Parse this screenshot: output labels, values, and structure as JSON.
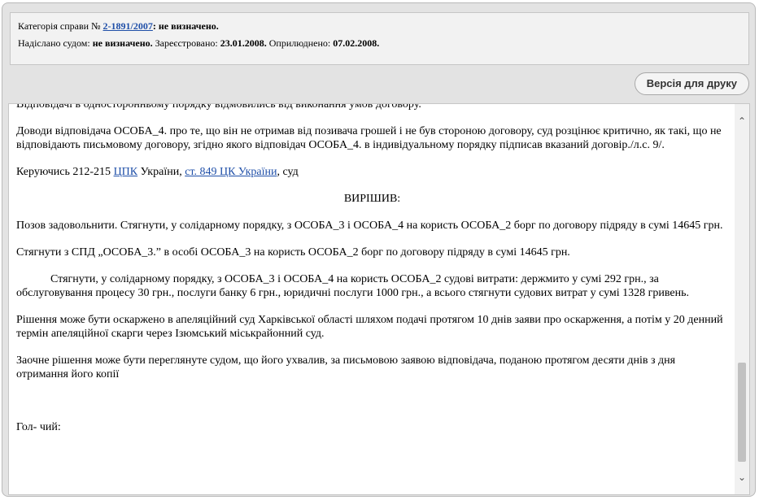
{
  "header": {
    "category_prefix": "Категорія справи №",
    "case_number": "2-1891/2007",
    "category_value": ": не визначено.",
    "sent_label": "Надіслано судом:",
    "sent_value": "не визначено.",
    "registered_label": "Зареєстровано:",
    "registered_value": "23.01.2008.",
    "published_label": "Оприлюднено:",
    "published_value": "07.02.2008."
  },
  "toolbar": {
    "print_label": "Версія для друку"
  },
  "document": {
    "p0": "Відповідачі в односторонньому порядку відмовились від виконання умов договору.",
    "p1": "Доводи відповідача ОСОБА_4. про те, що він не отримав від позивача грошей і не був стороною договору, суд розцінює критично, як такі, що не відповідають письмовому договору, згідно якого відповідач ОСОБА_4. в індивідуальному порядку підписав вказаний договір./л.с. 9/.",
    "p2_start": "Керуючись 212-215 ",
    "p2_link1": "ЦПК",
    "p2_mid": " України, ",
    "p2_link2": "ст. 849 ЦК України",
    "p2_end": ", суд",
    "decided": "ВИРІШИВ:",
    "p3": "Позов задовольнити. Стягнути, у солідарному порядку, з ОСОБА_3 і ОСОБА_4 на користь ОСОБА_2 борг по договору підряду в сумі 14645 грн.",
    "p4": "Стягнути з СПД „ОСОБА_3.” в особі ОСОБА_3 на користь ОСОБА_2 борг по договору підряду в сумі 14645 грн.",
    "p5": "Стягнути, у солідарному порядку, з ОСОБА_3 і ОСОБА_4 на користь ОСОБА_2 судові витрати: держмито у сумі 292 грн., за обслуговування процесу 30 грн., послуги банку 6 грн., юридичні послуги 1000 грн., а всього стягнути судових витрат у сумі 1328 гривень.",
    "p6": "Рішення може бути оскаржено в апеляційний суд Харківської області шляхом подачі протягом 10 днів заяви про оскарження, а потім у 20 денний термін апеляційної скарги через Ізюмський міськрайонний суд.",
    "p7": "Заочне рішення може бути переглянуте судом, що його ухвалив, за письмовою заявою відповідача, поданою протягом десяти днів з дня отримання його копії",
    "signature": "Гол- чий:"
  },
  "icons": {
    "scroll_up": "chevron-up-icon",
    "scroll_down": "chevron-down-icon"
  }
}
